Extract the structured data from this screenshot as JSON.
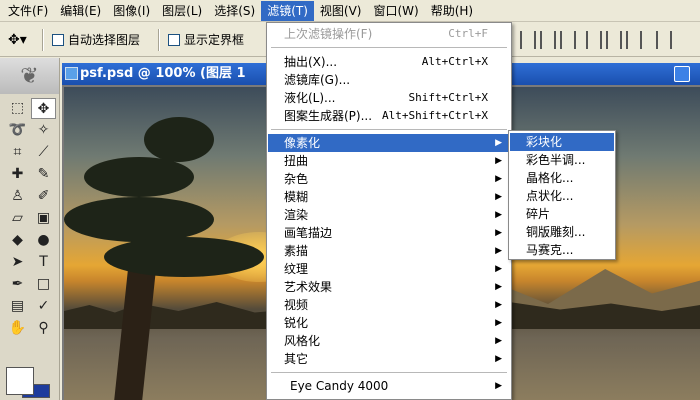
{
  "menubar": {
    "items": [
      {
        "label": "文件(F)"
      },
      {
        "label": "编辑(E)"
      },
      {
        "label": "图像(I)"
      },
      {
        "label": "图层(L)"
      },
      {
        "label": "选择(S)"
      },
      {
        "label": "滤镜(T)"
      },
      {
        "label": "视图(V)"
      },
      {
        "label": "窗口(W)"
      },
      {
        "label": "帮助(H)"
      }
    ]
  },
  "options": {
    "tool_icon": "✥▾",
    "auto_select": "自动选择图层",
    "show_bounds": "显示定界框"
  },
  "document": {
    "title": "psf.psd @ 100% (图层 1"
  },
  "filter_menu": {
    "last_filter": {
      "label": "上次滤镜操作(F)",
      "shortcut": "Ctrl+F"
    },
    "group1": [
      {
        "label": "抽出(X)...",
        "shortcut": "Alt+Ctrl+X"
      },
      {
        "label": "滤镜库(G)...",
        "shortcut": ""
      },
      {
        "label": "液化(L)...",
        "shortcut": "Shift+Ctrl+X"
      },
      {
        "label": "图案生成器(P)...",
        "shortcut": "Alt+Shift+Ctrl+X"
      }
    ],
    "group2": [
      {
        "label": "像素化"
      },
      {
        "label": "扭曲"
      },
      {
        "label": "杂色"
      },
      {
        "label": "模糊"
      },
      {
        "label": "渲染"
      },
      {
        "label": "画笔描边"
      },
      {
        "label": "素描"
      },
      {
        "label": "纹理"
      },
      {
        "label": "艺术效果"
      },
      {
        "label": "视频"
      },
      {
        "label": "锐化"
      },
      {
        "label": "风格化"
      },
      {
        "label": "其它"
      }
    ],
    "group3": [
      {
        "label": "Eye Candy 4000"
      }
    ],
    "arrow": "▶"
  },
  "pixelate_submenu": {
    "items": [
      {
        "label": "彩块化"
      },
      {
        "label": "彩色半调..."
      },
      {
        "label": "晶格化..."
      },
      {
        "label": "点状化..."
      },
      {
        "label": "碎片"
      },
      {
        "label": "铜版雕刻..."
      },
      {
        "label": "马赛克..."
      }
    ]
  },
  "colors": {
    "menu_highlight": "#316ac5",
    "titlebar": "#2f6fd6",
    "chrome": "#ece9d8",
    "background_color_swatch": "#1e3c9c",
    "foreground_color_swatch": "#ffffff"
  },
  "icons": {
    "tools": [
      "marquee-icon",
      "move-icon",
      "lasso-icon",
      "magic-wand-icon",
      "crop-icon",
      "slice-icon",
      "healing-brush-icon",
      "brush-icon",
      "clone-stamp-icon",
      "history-brush-icon",
      "eraser-icon",
      "gradient-icon",
      "blur-icon",
      "dodge-icon",
      "path-select-icon",
      "type-icon",
      "pen-icon",
      "shape-icon",
      "notes-icon",
      "eyedropper-icon",
      "hand-icon",
      "zoom-icon"
    ]
  }
}
